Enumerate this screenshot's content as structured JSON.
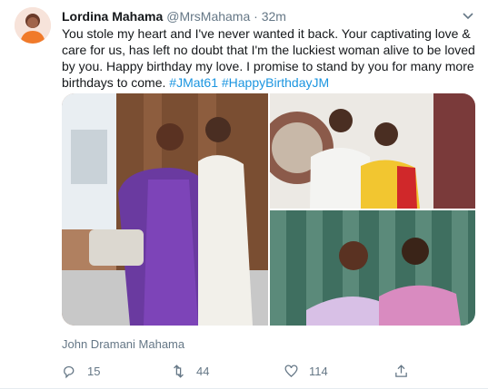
{
  "tweet": {
    "author_name": "Lordina Mahama",
    "author_handle": "@MrsMahama",
    "separator": "·",
    "time": "32m",
    "text_main": "You stole my heart and I've never wanted it back. Your captivating love & care for us, has left no doubt that I'm the luckiest woman alive to be loved by you. Happy birthday my love. I promise to stand by you for many more birthdays to come.",
    "hashtags": [
      "#JMat61",
      "#HappyBirthdayJM"
    ],
    "tagged_caption": "John Dramani Mahama",
    "counts": {
      "replies": "15",
      "retweets": "44",
      "likes": "114"
    },
    "icons": [
      "reply-icon",
      "retweet-icon",
      "like-icon",
      "share-icon",
      "chevron-down-icon"
    ],
    "colors": {
      "link": "#1b95e0",
      "muted": "#657786",
      "text": "#14171a"
    }
  }
}
